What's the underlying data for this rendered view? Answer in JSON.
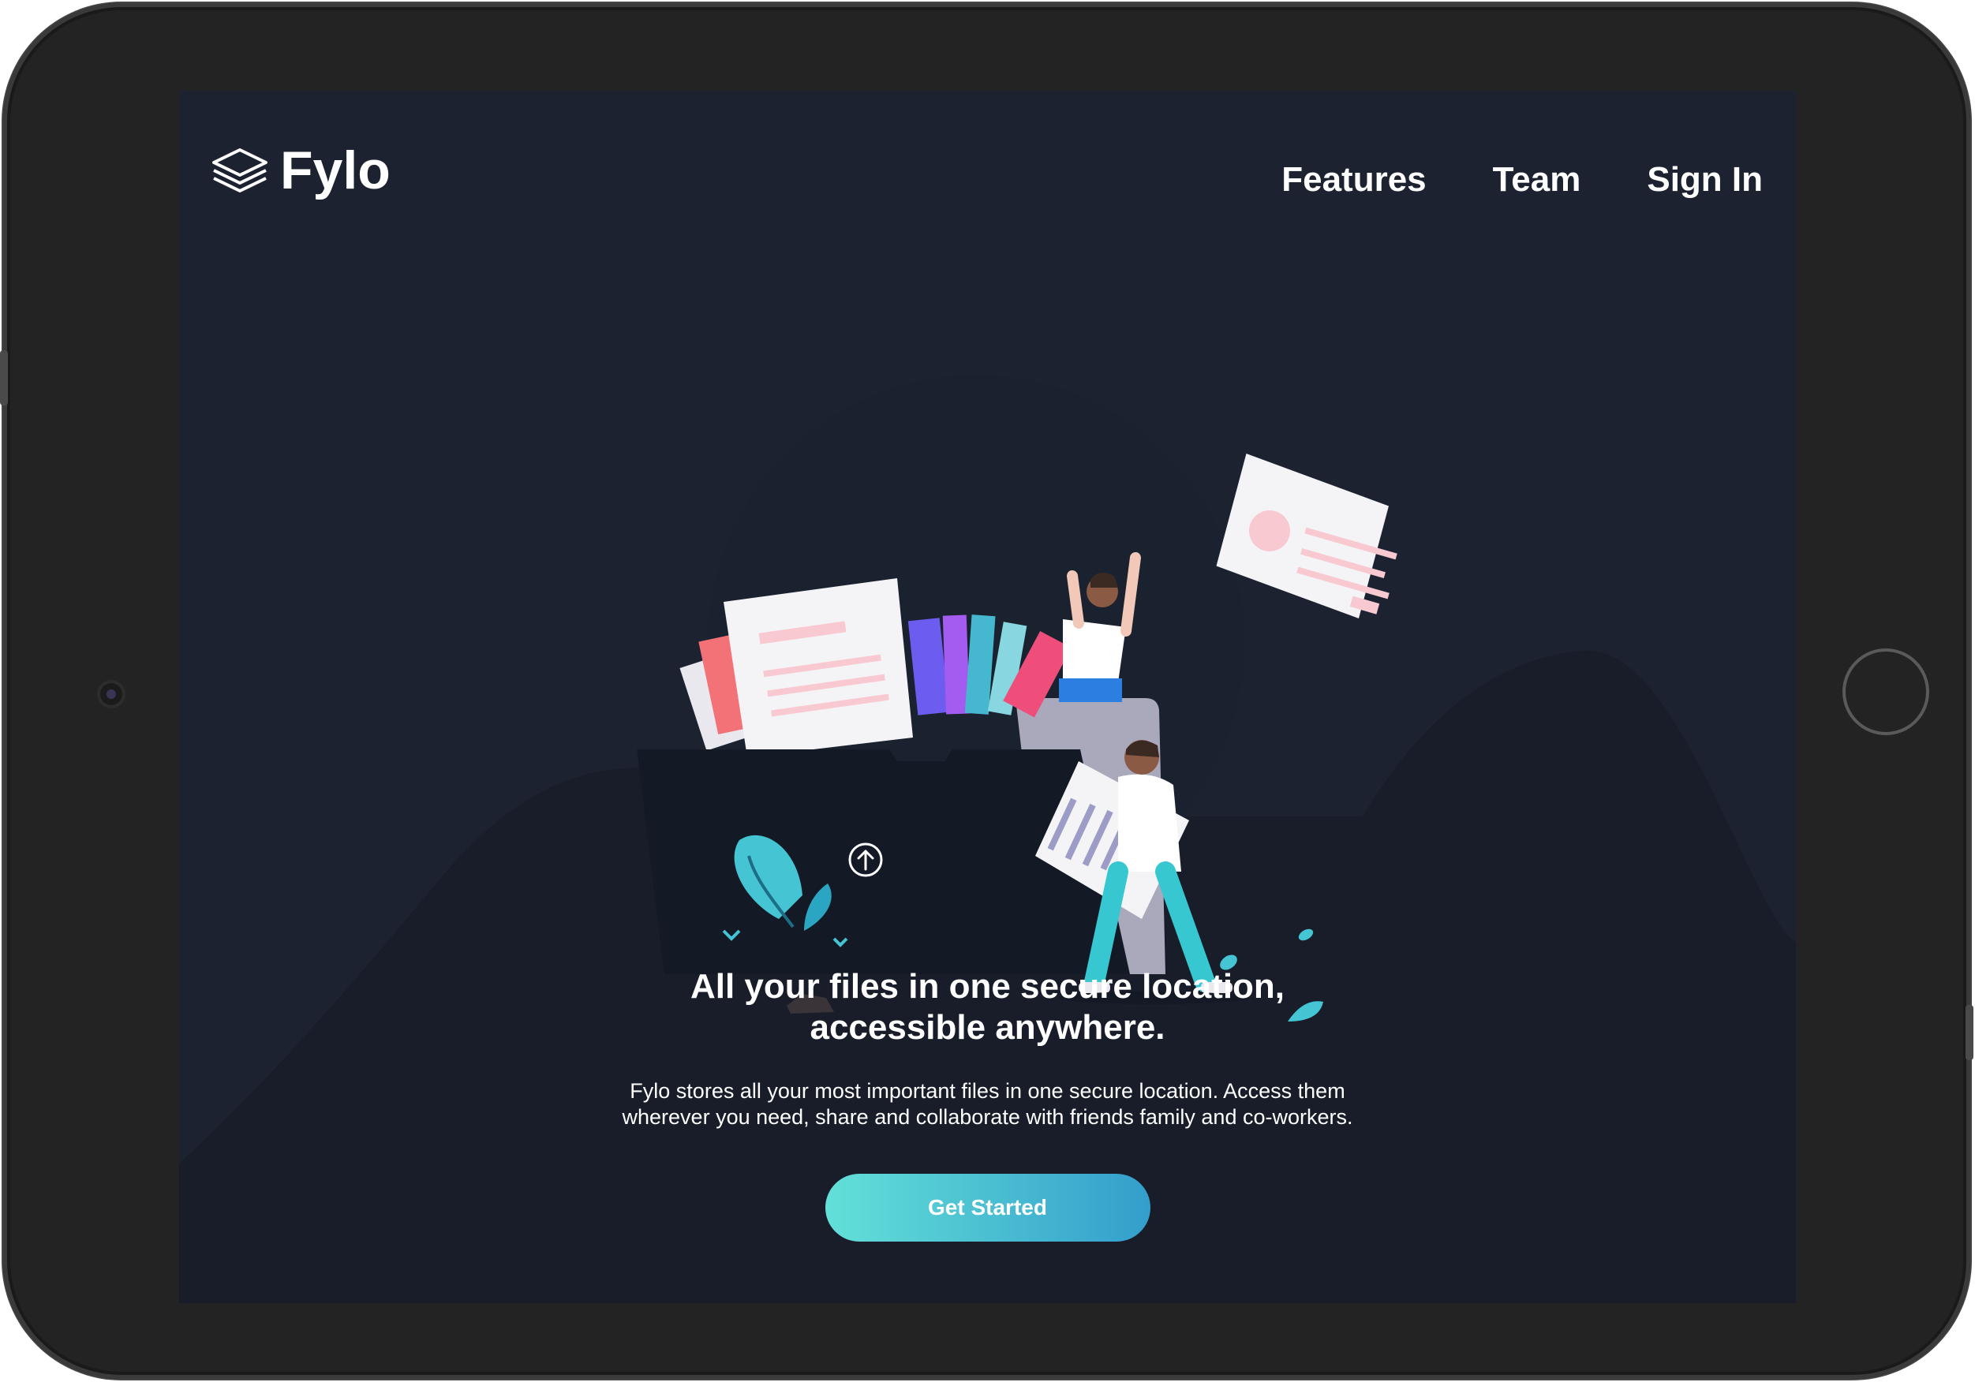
{
  "brand": {
    "name": "Fylo",
    "logo_icon": "stacked-layers-icon"
  },
  "nav": {
    "items": [
      {
        "label": "Features"
      },
      {
        "label": "Team"
      },
      {
        "label": "Sign In"
      }
    ]
  },
  "hero": {
    "illustration": "file-folder-upload-illustration",
    "headline": "All your files in one secure location, accessible anywhere.",
    "description": "Fylo stores all your most important files in one secure location. Access them wherever you need, share and collaborate with friends family and co-workers.",
    "cta_label": "Get Started"
  },
  "colors": {
    "background": "#1c2230",
    "hill": "#181d29",
    "accent_start": "#63e0d8",
    "accent_end": "#339ecc",
    "text": "#ffffff"
  }
}
